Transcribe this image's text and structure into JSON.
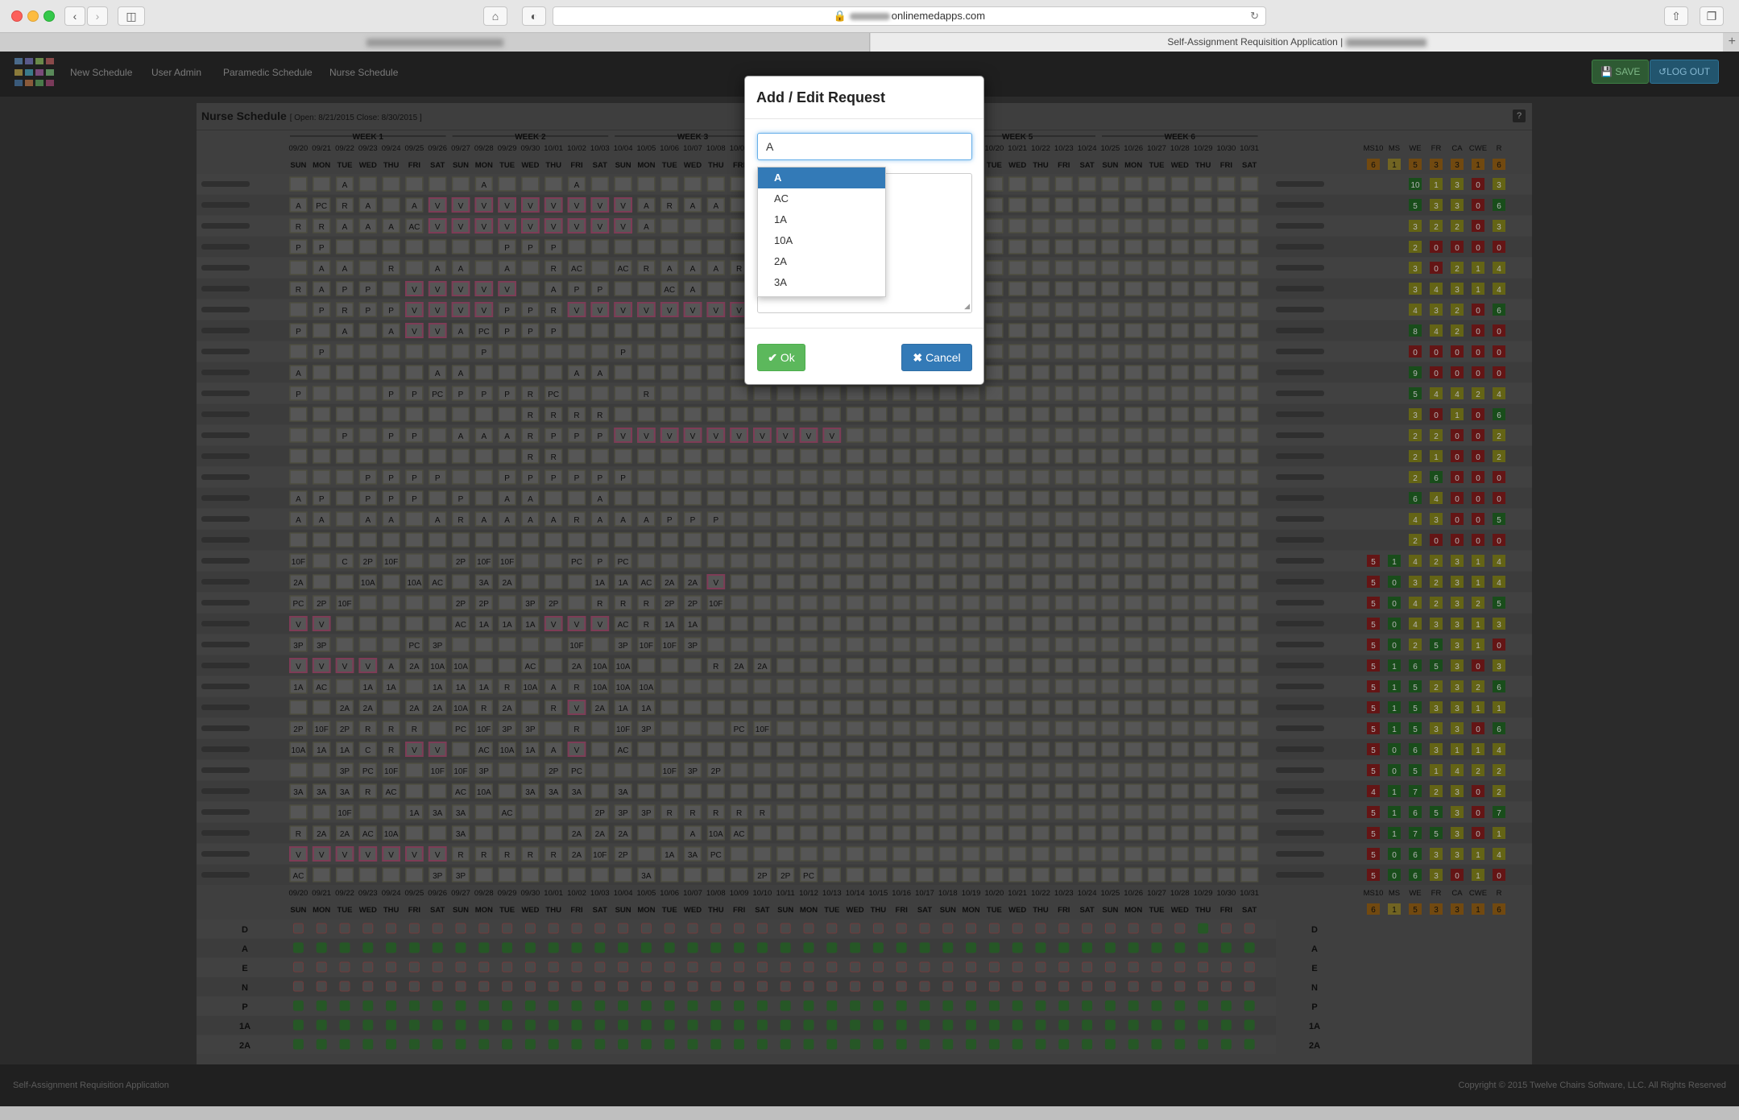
{
  "browser": {
    "url_domain": "onlinemedapps.com",
    "tab_title": "Self-Assignment Requisition Application |"
  },
  "nav": {
    "links": [
      "New Schedule",
      "User Admin",
      "Paramedic Schedule",
      "Nurse Schedule"
    ],
    "save_label": "SAVE",
    "logout_label": "LOG OUT"
  },
  "schedule": {
    "title": "Nurse Schedule",
    "period": "[ Open: 8/21/2015 Close: 8/30/2015 ]",
    "help": "?",
    "weeks": [
      "WEEK 1",
      "WEEK 2",
      "WEEK 3",
      "WEEK 4",
      "WEEK 5",
      "WEEK 6"
    ],
    "dates": [
      "09/20",
      "09/21",
      "09/22",
      "09/23",
      "09/24",
      "09/25",
      "09/26",
      "09/27",
      "09/28",
      "09/29",
      "09/30",
      "10/01",
      "10/02",
      "10/03",
      "10/04",
      "10/05",
      "10/06",
      "10/07",
      "10/08",
      "10/09",
      "10/10",
      "10/11",
      "10/12",
      "10/13",
      "10/14",
      "10/15",
      "10/16",
      "10/17",
      "10/18",
      "10/19",
      "10/20",
      "10/21",
      "10/22",
      "10/23",
      "10/24",
      "10/25",
      "10/26",
      "10/27",
      "10/28",
      "10/29",
      "10/30",
      "10/31"
    ],
    "days": [
      "SUN",
      "MON",
      "TUE",
      "WED",
      "THU",
      "FRI",
      "SAT"
    ],
    "summary_headers": [
      "MS10",
      "MS",
      "WE",
      "FR",
      "CA",
      "CWE",
      "R"
    ],
    "summary_header_counts": [
      "6",
      "1",
      "5",
      "3",
      "3",
      "1",
      "6"
    ],
    "rows": [
      {
        "s": "..A.....A...A...............................",
        "stats": [
          "",
          "",
          "10",
          "1",
          "3",
          "0",
          "3"
        ]
      },
      {
        "s": "APCRA.AVVVVVVVVVARAA........................",
        "stats": [
          "",
          "",
          "5",
          "3",
          "3",
          "0",
          "6"
        ]
      },
      {
        "s": "RRAAAACVVVVVVVVVA...........................",
        "stats": [
          "",
          "",
          "3",
          "2",
          "2",
          "0",
          "3"
        ]
      },
      {
        "s": "PP.......PPP................................",
        "stats": [
          "",
          "",
          "2",
          "0",
          "0",
          "0",
          "0"
        ]
      },
      {
        "s": ".AA.R.AA.A.RAC.ACRAAAR......................",
        "stats": [
          "",
          "",
          "3",
          "0",
          "2",
          "1",
          "4"
        ]
      },
      {
        "s": "RAPP.VVVVV.APP..ACA.........................",
        "stats": [
          "",
          "",
          "3",
          "4",
          "3",
          "1",
          "4"
        ]
      },
      {
        "s": ".PRPPVVVVPPRVVVVVVVV........................",
        "stats": [
          "",
          "",
          "4",
          "3",
          "2",
          "0",
          "6"
        ]
      },
      {
        "s": "P.A.AVVAPCPPP...............................",
        "stats": [
          "",
          "",
          "8",
          "4",
          "2",
          "0",
          "0"
        ]
      },
      {
        "s": ".P......P.....P.............................",
        "stats": [
          "",
          "",
          "0",
          "0",
          "0",
          "0",
          "0"
        ]
      },
      {
        "s": "A.....AA....AA..............................",
        "stats": [
          "",
          "",
          "9",
          "0",
          "0",
          "0",
          "0"
        ]
      },
      {
        "s": "P...PPPCPPPRPC...R..........................",
        "stats": [
          "",
          "",
          "5",
          "4",
          "4",
          "2",
          "4"
        ]
      },
      {
        "s": "..........RRRR..............................",
        "stats": [
          "",
          "",
          "3",
          "0",
          "1",
          "0",
          "6"
        ]
      },
      {
        "s": "..P.PP.AAARPPPVVVVVVVVVV....................",
        "stats": [
          "",
          "",
          "2",
          "2",
          "0",
          "0",
          "2"
        ]
      },
      {
        "s": "..........RR................................",
        "stats": [
          "",
          "",
          "2",
          "1",
          "0",
          "0",
          "2"
        ]
      },
      {
        "s": "...PPPP..PPPPPP.............................",
        "stats": [
          "",
          "",
          "2",
          "6",
          "0",
          "0",
          "0"
        ]
      },
      {
        "s": "AP.PPP.P.AA..A..............................",
        "stats": [
          "",
          "",
          "6",
          "4",
          "0",
          "0",
          "0"
        ]
      },
      {
        "s": "AA.AA.ARAAAARAAAPPP.........................",
        "stats": [
          "",
          "",
          "4",
          "3",
          "0",
          "0",
          "5"
        ]
      },
      {
        "s": "............................................",
        "stats": [
          "",
          "",
          "2",
          "0",
          "0",
          "0",
          "0"
        ]
      },
      {
        "s": "10F.C2P10F..2P10F10F..PCPPC.................",
        "stats": [
          "5",
          "1",
          "4",
          "2",
          "3",
          "1",
          "4"
        ]
      },
      {
        "s": "2A..10A.10AAC.3A2A...1A1AAC2A2AV............",
        "stats": [
          "5",
          "0",
          "3",
          "2",
          "3",
          "1",
          "4"
        ]
      },
      {
        "s": "PC2P10F....2P2P.3P2P.RRR2P2P10F.............",
        "stats": [
          "5",
          "0",
          "4",
          "2",
          "3",
          "2",
          "5"
        ]
      },
      {
        "s": "VV.....AC1A1A1AVVVACR1A1A...................",
        "stats": [
          "5",
          "0",
          "4",
          "3",
          "3",
          "1",
          "3"
        ]
      },
      {
        "s": "3P3P...PC3P.....10F.3P10F10F3P..............",
        "stats": [
          "5",
          "0",
          "2",
          "5",
          "3",
          "1",
          "0"
        ]
      },
      {
        "s": "VVVVA2A10A10A..AC.2A10A10A...R2A2A..........",
        "stats": [
          "5",
          "1",
          "6",
          "5",
          "3",
          "0",
          "3"
        ]
      },
      {
        "s": "1AAC.1A1A.1A1A1AR10AAR10A10A10A.............",
        "stats": [
          "5",
          "1",
          "5",
          "2",
          "3",
          "2",
          "6"
        ]
      },
      {
        "s": "..2A2A.2A2A10AR2A.RV2A1A1A..................",
        "stats": [
          "5",
          "1",
          "5",
          "3",
          "3",
          "1",
          "1"
        ]
      },
      {
        "s": "2P10F2PRRR.PC10F3P3P.R.10F3P...PC10F........",
        "stats": [
          "5",
          "1",
          "5",
          "3",
          "3",
          "0",
          "6"
        ]
      },
      {
        "s": "10A1A1ACRVV.AC10A1AAV.AC....................",
        "stats": [
          "5",
          "0",
          "6",
          "3",
          "1",
          "1",
          "4"
        ]
      },
      {
        "s": "..3PPC10F.10F10F3P..2PPC...10F3P2P..........",
        "stats": [
          "5",
          "0",
          "5",
          "1",
          "4",
          "2",
          "2"
        ]
      },
      {
        "s": "3A3A3ARAC..AC10A.3A3A3A.3A..................",
        "stats": [
          "4",
          "1",
          "7",
          "2",
          "3",
          "0",
          "2"
        ]
      },
      {
        "s": "..10F..1A3A3A.AC...2P3P3PRRRRR..............",
        "stats": [
          "5",
          "1",
          "6",
          "5",
          "3",
          "0",
          "7"
        ]
      },
      {
        "s": "R2A2AAC10A..3A....2A2A2A..A10AAC............",
        "stats": [
          "5",
          "1",
          "7",
          "5",
          "3",
          "0",
          "1"
        ]
      },
      {
        "s": "VVVVVVVRRRRR2A10F2P.1A3APC..................",
        "stats": [
          "5",
          "0",
          "6",
          "3",
          "3",
          "1",
          "4"
        ]
      },
      {
        "s": "AC.....3P3P.......3A....2P2PPC..............",
        "stats": [
          "5",
          "0",
          "6",
          "3",
          "0",
          "1",
          "0"
        ]
      }
    ],
    "coverage_labels": [
      "D",
      "A",
      "E",
      "N",
      "P",
      "1A",
      "2A"
    ]
  },
  "modal": {
    "title": "Add / Edit Request",
    "input_value": "A",
    "options": [
      "A",
      "AC",
      "1A",
      "10A",
      "2A",
      "3A"
    ],
    "selected_option": "A",
    "ok_label": "Ok",
    "cancel_label": "Cancel"
  },
  "footer": {
    "left": "Self-Assignment Requisition Application",
    "right": "Copyright © 2015 Twelve Chairs Software, LLC. All Rights Reserved"
  },
  "colors": {
    "modal_selected": "#337ab7",
    "ok_green": "#5cb85c",
    "cancel_blue": "#337ab7",
    "stat_red": "#8b1c1c",
    "stat_green": "#1f6b24",
    "stat_yellow": "#8a8a1e",
    "stat_orange": "#8a5a14"
  }
}
